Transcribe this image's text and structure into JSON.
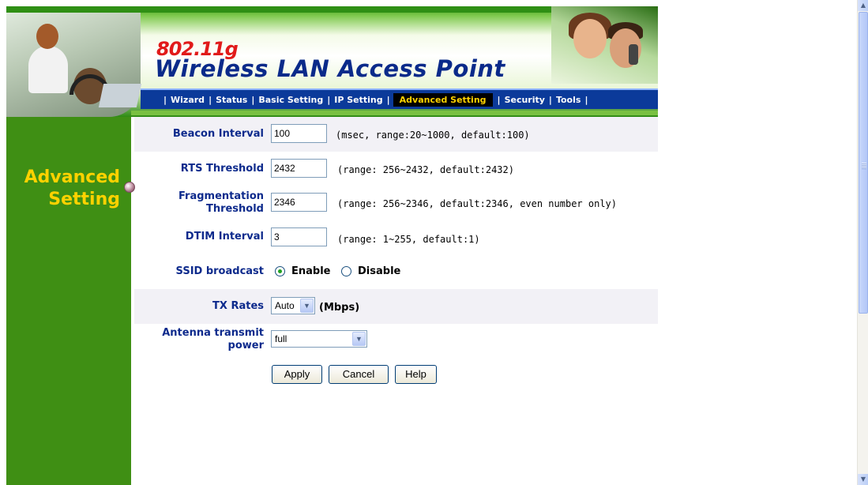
{
  "header": {
    "brand_small": "802.11g",
    "brand_big": "Wireless LAN Access Point",
    "nav": [
      "Wizard",
      "Status",
      "Basic Setting",
      "IP Setting",
      "Advanced Setting",
      "Security",
      "Tools"
    ],
    "active_nav": "Advanced Setting"
  },
  "sidebar": {
    "title_line1": "Advanced",
    "title_line2": "Setting"
  },
  "form": {
    "beacon": {
      "label": "Beacon Interval",
      "value": "100",
      "hint": "(msec, range:20~1000, default:100)"
    },
    "rts": {
      "label": "RTS Threshold",
      "value": "2432",
      "hint": "(range: 256~2432, default:2432)"
    },
    "frag": {
      "label_line1": "Fragmentation",
      "label_line2": "Threshold",
      "value": "2346",
      "hint": "(range: 256~2346, default:2346, even number only)"
    },
    "dtim": {
      "label": "DTIM Interval",
      "value": "3",
      "hint": "(range: 1~255, default:1)"
    },
    "ssid": {
      "label": "SSID broadcast",
      "enable": "Enable",
      "disable": "Disable",
      "selected": "Enable"
    },
    "tx": {
      "label": "TX Rates",
      "value": "Auto",
      "unit": "(Mbps)"
    },
    "antenna": {
      "label_line1": "Antenna transmit",
      "label_line2": "power",
      "value": "full"
    }
  },
  "buttons": {
    "apply": "Apply",
    "cancel": "Cancel",
    "help": "Help"
  },
  "colors": {
    "nav_bg": "#0b3a9a",
    "sidebar_green": "#3f8f14",
    "label_blue": "#0d2a8c",
    "accent_yellow": "#ffd200"
  }
}
